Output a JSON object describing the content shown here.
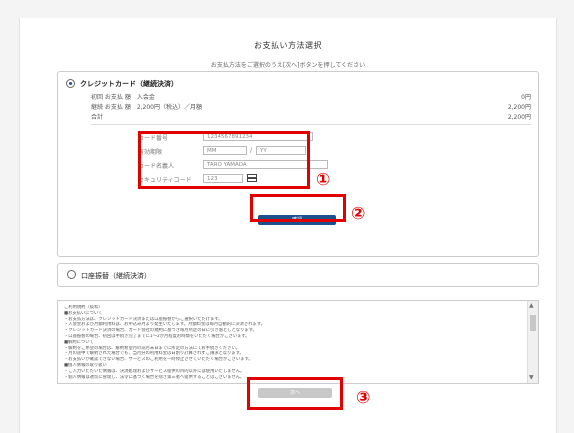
{
  "header": {
    "title": "お支払い方法選択",
    "subtitle": "お支払方法をご選択のうえ[次へ]ボタンを押してください"
  },
  "credit": {
    "label": "クレジットカード（継続決済）",
    "rows": [
      {
        "label": "初回 お支払 額　入会金",
        "value": "0円"
      },
      {
        "label": "継続 お支払 額　2,200円（税込）／月額",
        "value": "2,200円"
      },
      {
        "label": "合計",
        "value": "2,200円"
      }
    ],
    "fields": {
      "card_number": {
        "label": "カード番号",
        "value": "1234567891234"
      },
      "expiry": {
        "label": "有効期限",
        "month": "MM",
        "year": "YY"
      },
      "holder": {
        "label": "カード名義人",
        "value": "TARO YAMADA"
      },
      "security": {
        "label": "セキュリティコード",
        "value": "123"
      }
    },
    "confirm_button": "確認"
  },
  "bank": {
    "label": "口座振替（継続決済）"
  },
  "terms": {
    "lines": [
      "ご利用規約（抜粋）",
      "■お支払いについて",
      "・お支払方法は、クレジットカード決済または口座振替からご選択いただけます。",
      "・入会金および月額利用料は、お申込み月より発生いたします。月額料金は毎月自動的に決済されます。",
      "・クレジットカード決済の場合、カード会社の規約に基づき毎月所定の日に引き落としとなります。",
      "・口座振替の場合、初回は手続き完了までに1～2か月程度お時間をいただく場合がございます。",
      "■解約について",
      "・解約をご希望の場合は、解約希望月の前月末日までに所定の方法にてお手続きください。",
      "・月の途中で解約された場合でも、当月分の利用料金は日割り計算されずご請求となります。",
      "・お支払いが確認できない場合、サービスのご利用を一時停止させていただく場合がございます。",
      "■個人情報の取り扱い",
      "・ご入力いただいた情報は、決済処理およびサービス提供の目的以外には使用いたしません。",
      "・個人情報は適切に管理し、法令に基づく場合を除き第三者へ提供することはございません。"
    ]
  },
  "next_button": "次へ",
  "callouts": [
    "①",
    "②",
    "③"
  ],
  "colors": {
    "accent": "#1e4f8f",
    "highlight": "#e00000",
    "disabled": "#c8c8c8"
  }
}
